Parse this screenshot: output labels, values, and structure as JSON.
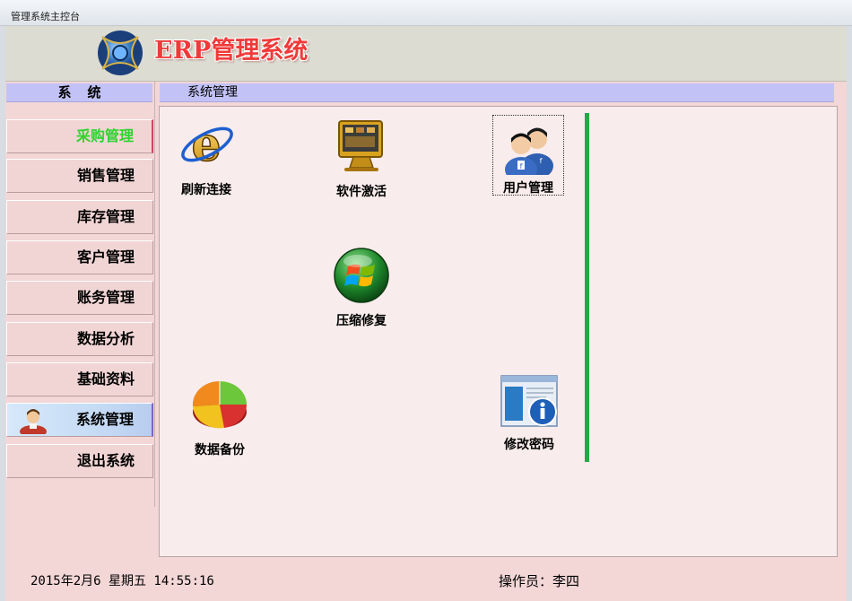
{
  "window": {
    "title": "管理系统主控台"
  },
  "banner": {
    "title": "ERP管理系统",
    "title_color": "#f03a3a"
  },
  "sidebar": {
    "header": "系统",
    "items": [
      {
        "label": "采购管理",
        "state": "highlighted-green"
      },
      {
        "label": "销售管理"
      },
      {
        "label": "库存管理"
      },
      {
        "label": "客户管理"
      },
      {
        "label": "账务管理"
      },
      {
        "label": "数据分析"
      },
      {
        "label": "基础资料"
      },
      {
        "label": "系统管理",
        "state": "selected",
        "icon": "user-avatar-icon"
      },
      {
        "label": "退出系统"
      }
    ]
  },
  "content": {
    "header": "系统管理",
    "tools": [
      {
        "label": "刷新连接",
        "icon": "internet-explorer-icon"
      },
      {
        "label": "软件激活",
        "icon": "monitor-icon"
      },
      {
        "label": "用户管理",
        "icon": "users-icon",
        "focused": true
      },
      {
        "label": "压缩修复",
        "icon": "windows-orb-icon"
      },
      {
        "label": "数据备份",
        "icon": "pie-chart-icon"
      },
      {
        "label": "修改密码",
        "icon": "info-window-icon"
      }
    ],
    "divider_color": "#22aa44"
  },
  "status": {
    "datetime": "2015年2月6 星期五 14:55:16",
    "operator": "操作员：李四"
  },
  "colors": {
    "background": "#f3d6d6",
    "header_bar": "#c2c2f6",
    "content_bg": "#f9ecec",
    "active_item_text": "#2fd32f"
  }
}
